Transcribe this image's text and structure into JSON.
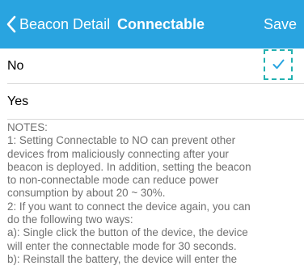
{
  "navbar": {
    "back_label": "Beacon Detail",
    "title": "Connectable",
    "save_label": "Save",
    "background": "#29a4e0"
  },
  "options": [
    {
      "label": "No",
      "selected": true
    },
    {
      "label": "Yes",
      "selected": false
    }
  ],
  "notes": {
    "lines": [
      "NOTES:",
      "1: Setting Connectable to NO can prevent other",
      "devices from maliciously connecting after your",
      "beacon is deployed. In addition, setting the beacon",
      "to non-connectable mode can reduce power",
      "consumption by about 20 ~ 30%.",
      "2: If you want to connect the device again, you can",
      "do the following two ways:",
      " a): Single click the button of the device, the device",
      "will enter the connectable mode for 30 seconds.",
      " b): Reinstall the battery, the device will enter the"
    ]
  },
  "icons": {
    "back": "chevron-left-icon",
    "check": "checkmark-icon"
  },
  "colors": {
    "accent": "#29a4e0",
    "check": "#29a4e0",
    "focus_outline": "#22b0b0",
    "notes_text": "#707070"
  }
}
